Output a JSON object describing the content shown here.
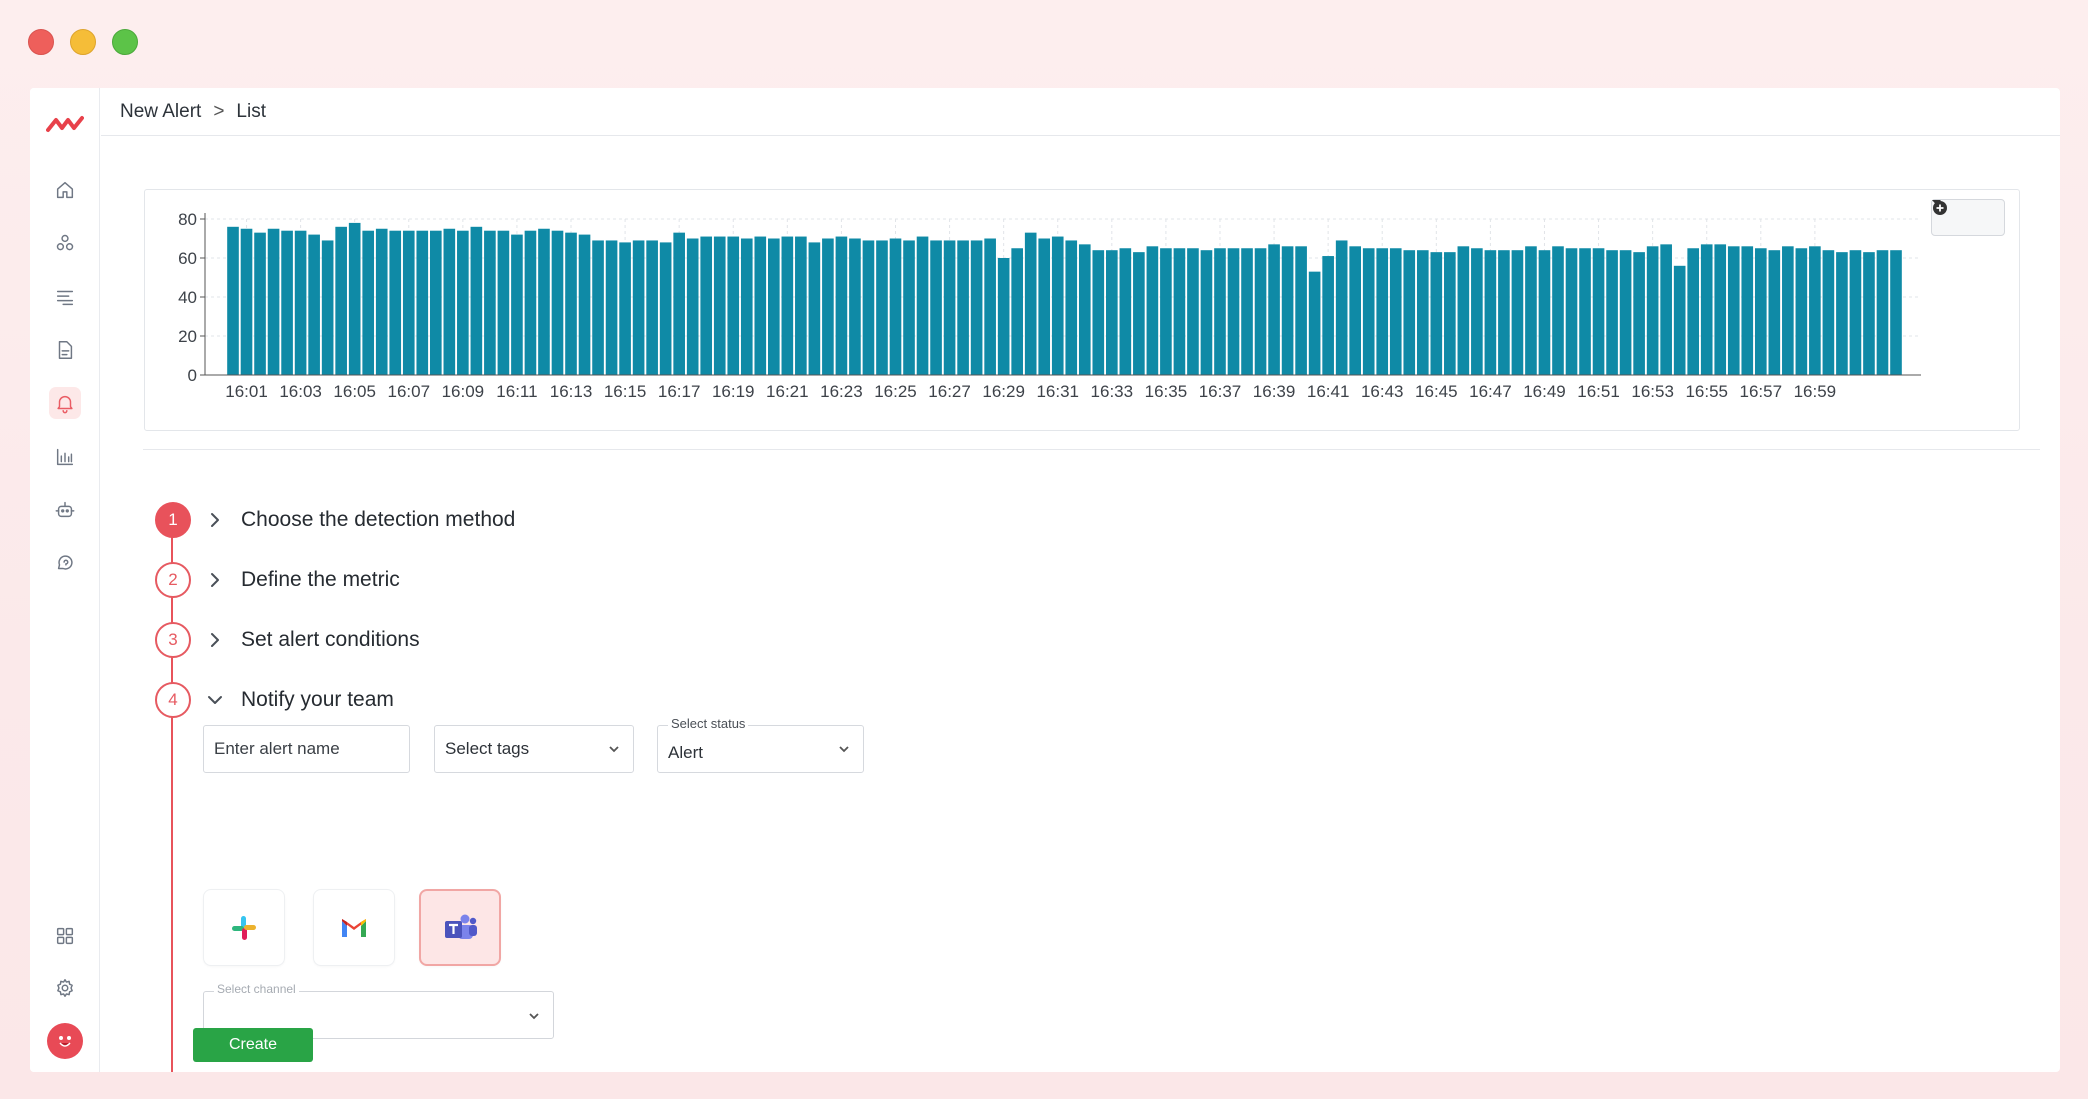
{
  "breadcrumb": {
    "parent": "New Alert",
    "separator": ">",
    "current": "List"
  },
  "sidebar": {
    "items": [
      {
        "icon": "home-icon",
        "active": false
      },
      {
        "icon": "services-icon",
        "active": false
      },
      {
        "icon": "logs-icon",
        "active": false
      },
      {
        "icon": "document-icon",
        "active": false
      },
      {
        "icon": "bell-icon",
        "active": true
      },
      {
        "icon": "bar-chart-icon",
        "active": false
      },
      {
        "icon": "robot-icon",
        "active": false
      },
      {
        "icon": "chat-icon",
        "active": false
      }
    ],
    "bottom_items": [
      {
        "icon": "grid-icon"
      },
      {
        "icon": "gear-icon"
      }
    ]
  },
  "chart_data": {
    "type": "bar",
    "color": "#0f8aa6",
    "ylim": [
      0,
      80
    ],
    "yticks": [
      0,
      20,
      40,
      60,
      80
    ],
    "grid": true,
    "x_ticks": [
      "16:01",
      "16:03",
      "16:05",
      "16:07",
      "16:09",
      "16:11",
      "16:13",
      "16:15",
      "16:17",
      "16:19",
      "16:21",
      "16:23",
      "16:25",
      "16:27",
      "16:29",
      "16:31",
      "16:33",
      "16:35",
      "16:37",
      "16:39",
      "16:41",
      "16:43",
      "16:45",
      "16:47",
      "16:49",
      "16:51",
      "16:53",
      "16:55",
      "16:57",
      "16:59"
    ],
    "values": [
      76,
      75,
      73,
      75,
      74,
      74,
      72,
      69,
      76,
      78,
      74,
      75,
      74,
      74,
      74,
      74,
      75,
      74,
      76,
      74,
      74,
      72,
      74,
      75,
      74,
      73,
      72,
      69,
      69,
      68,
      69,
      69,
      68,
      73,
      70,
      71,
      71,
      71,
      70,
      71,
      70,
      71,
      71,
      68,
      70,
      71,
      70,
      69,
      69,
      70,
      69,
      71,
      69,
      69,
      69,
      69,
      70,
      60,
      65,
      73,
      70,
      71,
      69,
      67,
      64,
      64,
      65,
      63,
      66,
      65,
      65,
      65,
      64,
      65,
      65,
      65,
      65,
      67,
      66,
      66,
      53,
      61,
      69,
      66,
      65,
      65,
      65,
      64,
      64,
      63,
      63,
      66,
      65,
      64,
      64,
      64,
      66,
      64,
      66,
      65,
      65,
      65,
      64,
      64,
      63,
      66,
      67,
      56,
      65,
      67,
      67,
      66,
      66,
      65,
      64,
      66,
      65,
      66,
      64,
      63,
      64,
      63,
      64,
      64
    ],
    "toolbar_icon": "plus-circle-icon"
  },
  "steps": [
    {
      "number": "1",
      "title": "Choose the detection method",
      "expanded": false,
      "active": true
    },
    {
      "number": "2",
      "title": "Define the metric",
      "expanded": false,
      "active": false
    },
    {
      "number": "3",
      "title": "Set alert conditions",
      "expanded": false,
      "active": false
    },
    {
      "number": "4",
      "title": "Notify your team",
      "expanded": true,
      "active": false
    }
  ],
  "notify": {
    "alert_name_placeholder": "Enter alert name",
    "tags_placeholder": "Select tags",
    "status_label": "Select status",
    "status_value": "Alert",
    "channel_label": "Select channel",
    "channels": [
      {
        "name": "slack-icon",
        "selected": false
      },
      {
        "name": "gmail-icon",
        "selected": false
      },
      {
        "name": "teams-icon",
        "selected": true
      }
    ]
  },
  "actions": {
    "create_label": "Create"
  }
}
